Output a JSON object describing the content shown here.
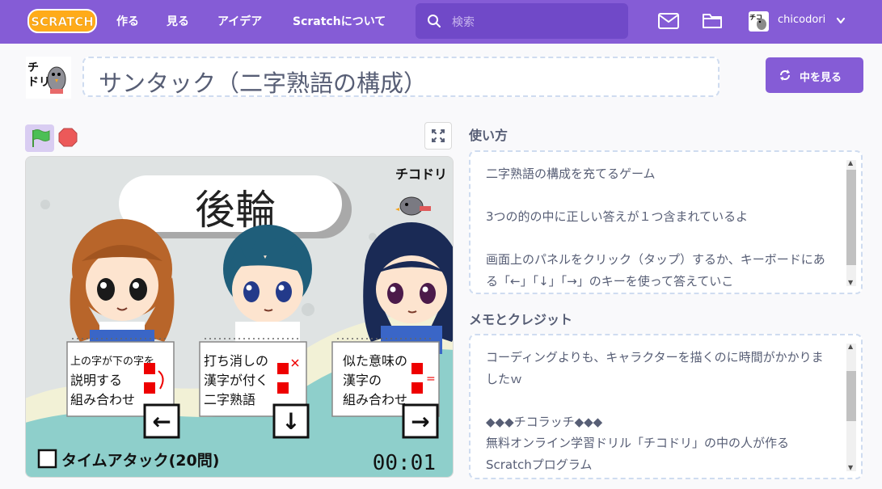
{
  "header": {
    "logo_text": "SCRATCH",
    "nav": [
      "作る",
      "見る",
      "アイデア",
      "Scratchについて"
    ],
    "search_placeholder": "検索",
    "username": "chicodori"
  },
  "project": {
    "title": "サンタック（二字熟語の構成）",
    "see_inside_label": "中を見る"
  },
  "stage": {
    "word": "後輪",
    "logo_text": "チコドリ",
    "panels": [
      {
        "lines": [
          "上の字が下の字を",
          "説明する",
          "組み合わせ"
        ],
        "key": "←"
      },
      {
        "lines": [
          "打ち消しの",
          "漢字が付く",
          "二字熟語"
        ],
        "key": "↓"
      },
      {
        "lines": [
          "似た意味の",
          "漢字の",
          "組み合わせ"
        ],
        "key": "→"
      }
    ],
    "time_attack_label": "タイムアタック(20問)",
    "timer": "00:01"
  },
  "instructions": {
    "heading": "使い方",
    "text": "二字熟語の構成を充てるゲーム\n\n3つの的の中に正しい答えが１つ含まれているよ\n\n画面上のパネルをクリック（タップ）するか、キーボードにある「←」「↓」「→」のキーを使って答えていこ"
  },
  "notes": {
    "heading": "メモとクレジット",
    "text": "コーディングよりも、キャラクターを描くのに時間がかかりましたｗ\n\n◆◆◆チコラッチ◆◆◆\n無料オンライン学習ドリル「チコドリ」の中の人が作るScratchプログラム"
  },
  "colors": {
    "header_bg": "#855cd6",
    "search_bg": "#7049c8",
    "button_bg": "#855cd6",
    "flag_active_bg": "#d9cdf2",
    "dashed_border": "#cfdcf0",
    "text": "#575e75"
  },
  "icons": [
    "scratch-logo",
    "search-icon",
    "mail-icon",
    "folder-icon",
    "chevron-down-icon",
    "remix-icon",
    "green-flag-icon",
    "stop-icon",
    "fullscreen-icon"
  ]
}
